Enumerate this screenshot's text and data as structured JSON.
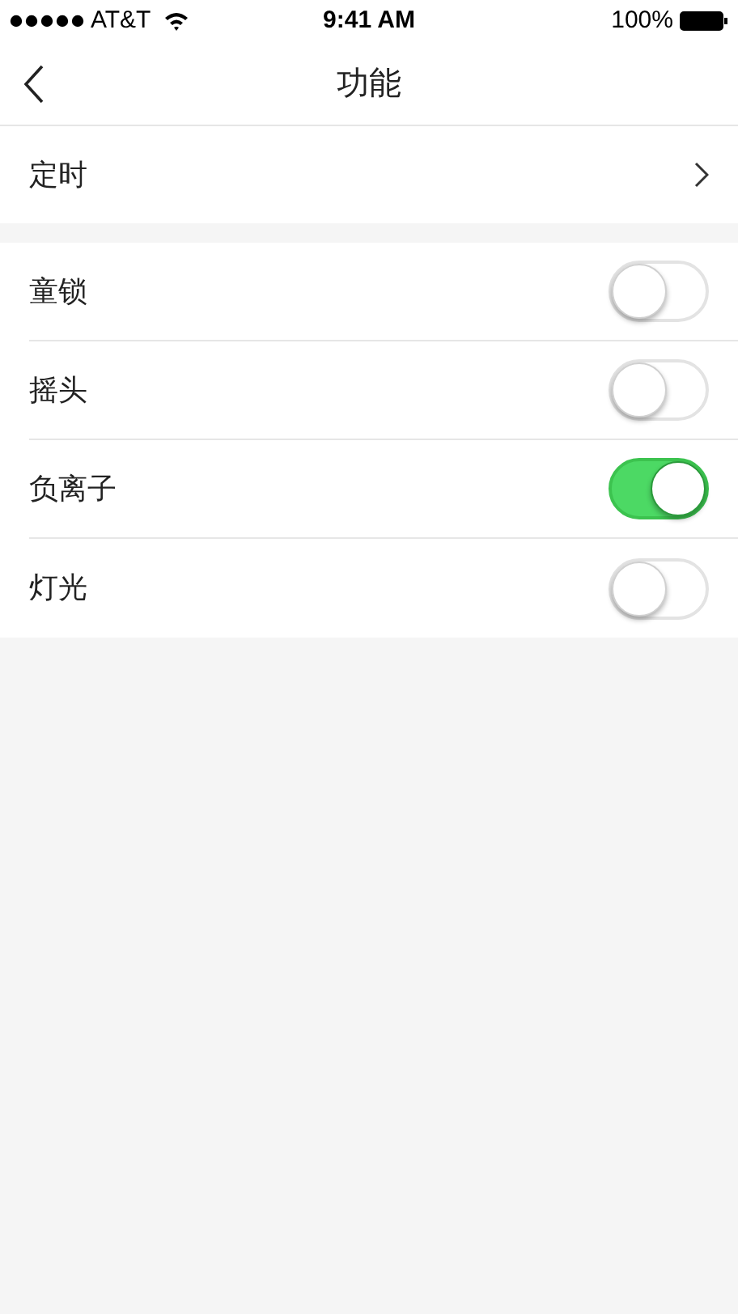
{
  "status_bar": {
    "carrier": "AT&T",
    "time": "9:41 AM",
    "battery": "100%"
  },
  "nav": {
    "title": "功能"
  },
  "timer": {
    "label": "定时"
  },
  "switches": [
    {
      "label": "童锁",
      "on": false
    },
    {
      "label": "摇头",
      "on": false
    },
    {
      "label": "负离子",
      "on": true
    },
    {
      "label": "灯光",
      "on": false
    }
  ]
}
